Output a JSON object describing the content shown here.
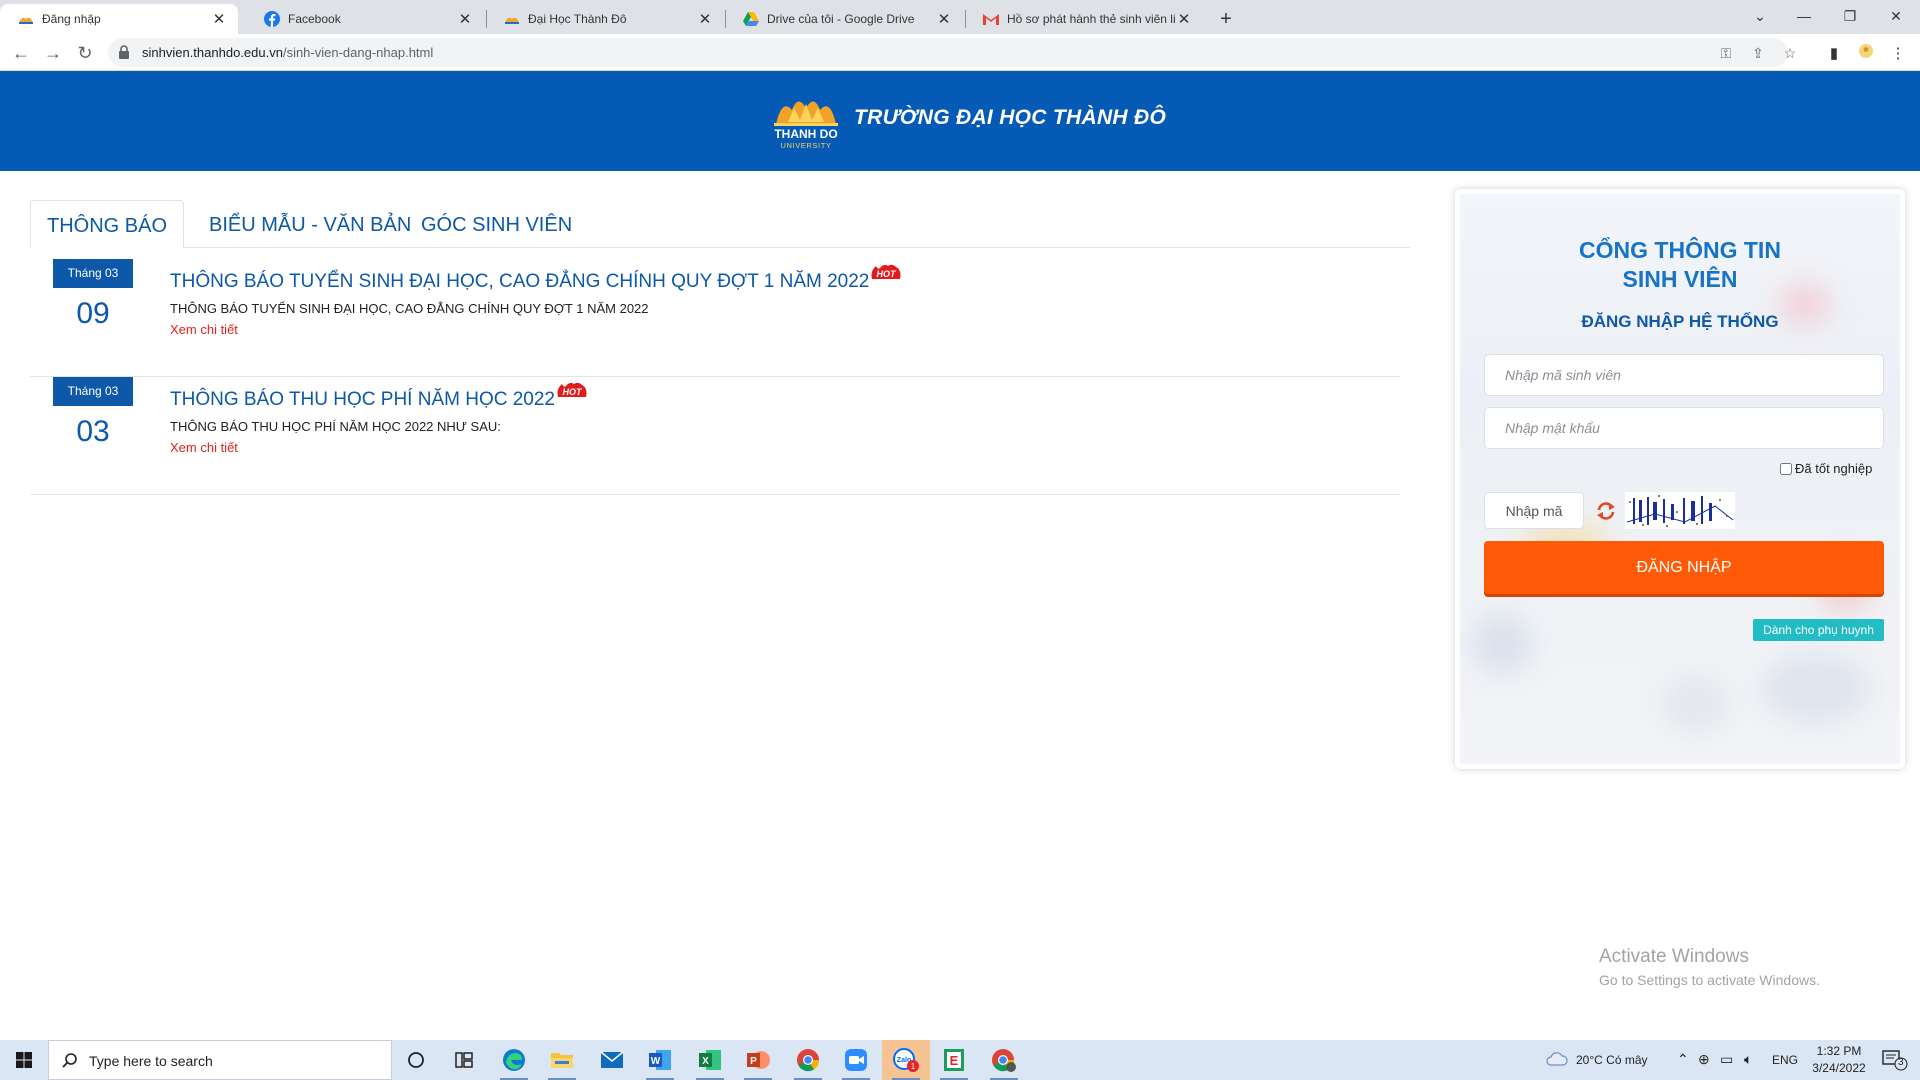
{
  "browser": {
    "tabs": [
      {
        "title": "Đăng nhập",
        "icon": "thanhdo-logo-icon",
        "active": true
      },
      {
        "title": "Facebook",
        "icon": "facebook-icon",
        "active": false
      },
      {
        "title": "Đại Học Thành Đô",
        "icon": "thanhdo-logo-icon",
        "active": false
      },
      {
        "title": "Drive của tôi - Google Drive",
        "icon": "google-drive-icon",
        "active": false
      },
      {
        "title": "Hồ sơ phát hành thẻ sinh viên liê",
        "icon": "gmail-icon",
        "active": false
      }
    ],
    "url_host": "sinhvien.thanhdo.edu.vn",
    "url_path": "/sinh-vien-dang-nhap.html"
  },
  "header": {
    "logo_text": "THANH DO",
    "logo_subtext": "UNIVERSITY",
    "title": "TRƯỜNG ĐẠI HỌC THÀNH ĐÔ",
    "background_color": "#045ab5"
  },
  "tabs": {
    "items": [
      {
        "label": "THÔNG BÁO",
        "active": true
      },
      {
        "label": "BIỂU MẪU - VĂN BẢN",
        "active": false
      },
      {
        "label": "GÓC SINH VIÊN",
        "active": false
      }
    ]
  },
  "news": [
    {
      "month": "Tháng 03",
      "day": "09",
      "title": "THÔNG BÁO TUYỂN SINH ĐẠI HỌC, CAO ĐẲNG CHÍNH QUY ĐỢT 1 NĂM 2022",
      "description": "THÔNG BÁO TUYỂN SINH ĐẠI HỌC, CAO ĐẲNG CHÍNH QUY ĐỢT 1 NĂM 2022",
      "link": "Xem chi tiết",
      "badge": "HOT"
    },
    {
      "month": "Tháng 03",
      "day": "03",
      "title": "THÔNG BÁO THU HỌC PHÍ NĂM HỌC 2022",
      "description": "THÔNG BÁO THU HỌC PHÍ NĂM HỌC 2022 NHƯ SAU:",
      "link": "Xem chi tiết",
      "badge": "HOT"
    }
  ],
  "login": {
    "title_line1": "CỔNG THÔNG TIN",
    "title_line2": "SINH VIÊN",
    "subtitle": "ĐĂNG NHẬP HỆ THỐNG",
    "student_id_placeholder": "Nhập mã sinh viên",
    "password_placeholder": "Nhập mật khẩu",
    "graduated_label": "Đã tốt nghiệp",
    "captcha_placeholder": "Nhập mã",
    "submit_label": "ĐĂNG NHẬP",
    "parent_label": "Dành cho phụ huynh",
    "accent_color": "#fe5a08"
  },
  "watermark": {
    "line1": "Activate Windows",
    "line2": "Go to Settings to activate Windows."
  },
  "taskbar": {
    "search_placeholder": "Type here to search",
    "weather": "20°C  Có mây",
    "language": "ENG",
    "time": "1:32 PM",
    "date": "3/24/2022",
    "notification_count": "3",
    "apps": [
      "task-view",
      "widgets",
      "edge",
      "file-explorer",
      "mail",
      "word",
      "excel",
      "powerpoint",
      "chrome",
      "zoom",
      "zalo",
      "evernote",
      "chrome-profile"
    ]
  }
}
